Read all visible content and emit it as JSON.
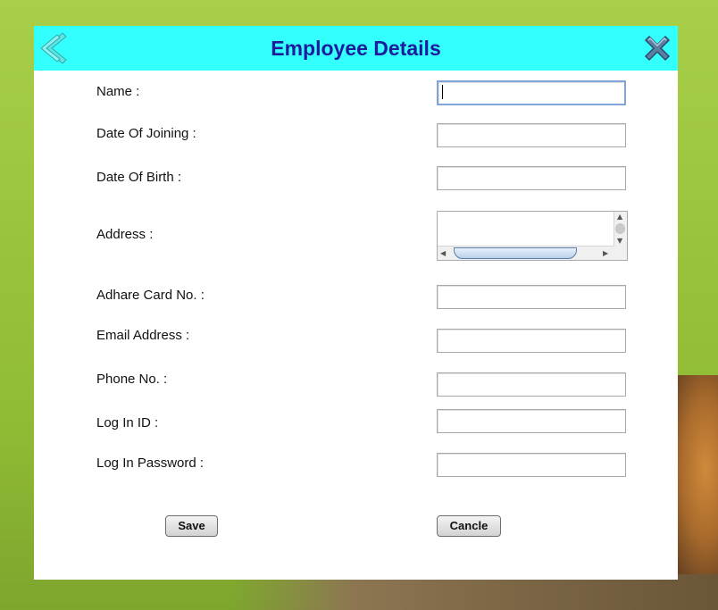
{
  "dialog": {
    "title": "Employee Details",
    "back_icon": "chevron-left-icon",
    "close_icon": "close-x-icon",
    "titlebar_color": "#33ffff",
    "title_color": "#1c1c9c"
  },
  "form": {
    "name_label": "Name :",
    "name_value": "",
    "doj_label": "Date Of Joining :",
    "doj_value": "",
    "dob_label": "Date Of Birth :",
    "dob_value": "",
    "address_label": "Address :",
    "address_value": "",
    "aadhar_label": "Adhare Card No. :",
    "aadhar_value": "",
    "email_label": "Email Address :",
    "email_value": "",
    "phone_label": "Phone No. :",
    "phone_value": "",
    "login_label": "Log In ID :",
    "login_value": "",
    "password_label": "Log In Password :",
    "password_value": ""
  },
  "buttons": {
    "save_label": "Save",
    "cancel_label": "Cancle"
  }
}
